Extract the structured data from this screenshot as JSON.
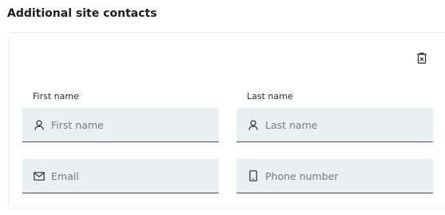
{
  "section": {
    "title": "Additional site contacts"
  },
  "contact": {
    "delete_icon": "trash-icon",
    "first_name": {
      "label": "First name",
      "placeholder": "First name",
      "value": "",
      "icon": "person-icon"
    },
    "last_name": {
      "label": "Last name",
      "placeholder": "Last name",
      "value": "",
      "icon": "person-icon"
    },
    "email": {
      "placeholder": "Email",
      "value": "",
      "icon": "envelope-icon"
    },
    "phone": {
      "placeholder": "Phone number",
      "value": "",
      "icon": "mobile-phone-icon"
    }
  },
  "colors": {
    "field_background": "#e9f0f2",
    "field_underline": "#4e4e4e",
    "placeholder": "#7a7a7a"
  }
}
